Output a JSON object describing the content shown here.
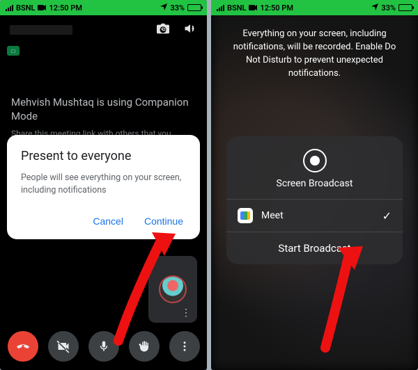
{
  "status": {
    "carrier": "BSNL",
    "time": "12:50 PM",
    "battery_pct": "33%"
  },
  "left": {
    "banner_user": "Mehvish Mushtaq is using Companion Mode",
    "banner_hint": "Share this meeting link with others that you",
    "dialog": {
      "title": "Present to everyone",
      "body": "People will see everything on your screen, including notifications",
      "cancel": "Cancel",
      "continue": "Continue"
    }
  },
  "right": {
    "warning": "Everything on your screen, including notifications, will be recorded. Enable Do Not Disturb to prevent unexpected notifications.",
    "panel_title": "Screen Broadcast",
    "app_name": "Meet",
    "start_label": "Start Broadcast"
  }
}
